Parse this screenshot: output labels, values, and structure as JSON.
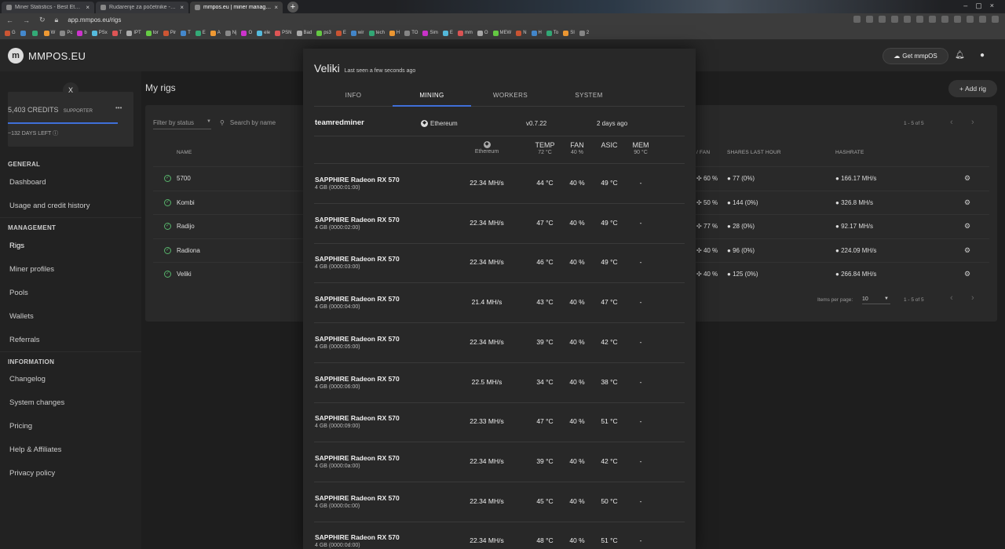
{
  "browser": {
    "tabs": [
      {
        "label": "Miner Statistics - Best Ethereum",
        "active": false
      },
      {
        "label": "Rudarenje za početnike - ČITAJ",
        "active": false
      },
      {
        "label": "mmpos.eu | miner management",
        "active": true
      }
    ],
    "url": "app.mmpos.eu/rigs",
    "bookmarks": [
      "G",
      "",
      "",
      "W",
      "Pc",
      "b",
      "PSx",
      "T",
      "IPT",
      "tor",
      "Pir",
      "T",
      "E",
      "A",
      "Nj",
      "O",
      "ele",
      "PSN",
      "Bad",
      "ps3",
      "E",
      "wir",
      "tech",
      "H",
      "TO",
      "Sim",
      "E",
      "mm",
      "O",
      "MEW",
      "N",
      "H",
      "To",
      "SI",
      "2"
    ]
  },
  "app": {
    "logo": "MMPOS.EU",
    "get_label": "Get mmpOS"
  },
  "sidebar": {
    "close": "X",
    "credits": "5,403 CREDITS",
    "badge": "SUPPORTER",
    "more": "•••",
    "credits_fill": 1.0,
    "days_left": "~132 DAYS LEFT",
    "sections": {
      "general": "GENERAL",
      "management": "MANAGEMENT",
      "information": "INFORMATION"
    },
    "items": {
      "dashboard": "Dashboard",
      "usage": "Usage and credit history",
      "rigs": "Rigs",
      "profiles": "Miner profiles",
      "pools": "Pools",
      "wallets": "Wallets",
      "referrals": "Referrals",
      "changelog": "Changelog",
      "system_changes": "System changes",
      "pricing": "Pricing",
      "help": "Help & Affiliates",
      "privacy": "Privacy policy"
    }
  },
  "main": {
    "title": "My rigs",
    "add_rig": "Add rig",
    "filter": "Filter by status",
    "search": "Search by name",
    "pager_top": "1 - 5 of 5",
    "pager_bottom": "1 - 5 of 5",
    "items_per_page_label": "Items per page:",
    "items_per_page": "10",
    "columns": {
      "name": "NAME",
      "fan": "/ FAN",
      "shares": "SHARES LAST HOUR",
      "hashrate": "HASHRATE"
    },
    "rigs": [
      {
        "name": "5700",
        "fan": "60 %",
        "shares": "77 (0%)",
        "hashrate": "166.17 MH/s"
      },
      {
        "name": "Kombi",
        "fan": "50 %",
        "shares": "144 (0%)",
        "hashrate": "326.8 MH/s"
      },
      {
        "name": "Radijo",
        "fan": "77 %",
        "shares": "28 (0%)",
        "hashrate": "92.17 MH/s"
      },
      {
        "name": "Radiona",
        "fan": "40 %",
        "shares": "96 (0%)",
        "hashrate": "224.09 MH/s"
      },
      {
        "name": "Veliki",
        "fan": "40 %",
        "shares": "125 (0%)",
        "hashrate": "266.84 MH/s"
      }
    ]
  },
  "modal": {
    "title": "Veliki",
    "subtitle": "Last seen a few seconds ago",
    "tabs": [
      "INFO",
      "MINING",
      "WORKERS",
      "SYSTEM"
    ],
    "active_tab": 1,
    "miner": {
      "name": "teamredminer",
      "coin": "Ethereum",
      "version": "v0.7.22",
      "ago": "2 days ago"
    },
    "headers": {
      "coin": "Ethereum",
      "temp": "TEMP",
      "temp_sub": "72 °C",
      "fan": "FAN",
      "fan_sub": "40 %",
      "asic": "ASIC",
      "mem": "MEM",
      "mem_sub": "90 °C"
    },
    "gpus": [
      {
        "name": "SAPPHIRE Radeon RX 570",
        "bus": "4 GB (0000:01:00)",
        "hash": "22.34 MH/s",
        "temp": "44 °C",
        "fan": "40 %",
        "asic": "49 °C",
        "mem": "-"
      },
      {
        "name": "SAPPHIRE Radeon RX 570",
        "bus": "4 GB (0000:02:00)",
        "hash": "22.34 MH/s",
        "temp": "47 °C",
        "fan": "40 %",
        "asic": "49 °C",
        "mem": "-"
      },
      {
        "name": "SAPPHIRE Radeon RX 570",
        "bus": "4 GB (0000:03:00)",
        "hash": "22.34 MH/s",
        "temp": "46 °C",
        "fan": "40 %",
        "asic": "49 °C",
        "mem": "-"
      },
      {
        "name": "SAPPHIRE Radeon RX 570",
        "bus": "4 GB (0000:04:00)",
        "hash": "21.4 MH/s",
        "temp": "43 °C",
        "fan": "40 %",
        "asic": "47 °C",
        "mem": "-"
      },
      {
        "name": "SAPPHIRE Radeon RX 570",
        "bus": "4 GB (0000:05:00)",
        "hash": "22.34 MH/s",
        "temp": "39 °C",
        "fan": "40 %",
        "asic": "42 °C",
        "mem": "-"
      },
      {
        "name": "SAPPHIRE Radeon RX 570",
        "bus": "4 GB (0000:06:00)",
        "hash": "22.5 MH/s",
        "temp": "34 °C",
        "fan": "40 %",
        "asic": "38 °C",
        "mem": "-"
      },
      {
        "name": "SAPPHIRE Radeon RX 570",
        "bus": "4 GB (0000:09:00)",
        "hash": "22.33 MH/s",
        "temp": "47 °C",
        "fan": "40 %",
        "asic": "51 °C",
        "mem": "-"
      },
      {
        "name": "SAPPHIRE Radeon RX 570",
        "bus": "4 GB (0000:0a:00)",
        "hash": "22.34 MH/s",
        "temp": "39 °C",
        "fan": "40 %",
        "asic": "42 °C",
        "mem": "-"
      },
      {
        "name": "SAPPHIRE Radeon RX 570",
        "bus": "4 GB (0000:0c:00)",
        "hash": "22.34 MH/s",
        "temp": "45 °C",
        "fan": "40 %",
        "asic": "50 °C",
        "mem": "-"
      },
      {
        "name": "SAPPHIRE Radeon RX 570",
        "bus": "4 GB (0000:0d:00)",
        "hash": "22.34 MH/s",
        "temp": "48 °C",
        "fan": "40 %",
        "asic": "51 °C",
        "mem": "-"
      }
    ]
  },
  "colors": {
    "accent": "#3f6fd8",
    "status_ok": "#57b36b"
  },
  "icons": [
    "back-icon",
    "forward-icon",
    "reload-icon",
    "cloud-download-icon",
    "bell-icon",
    "user-icon",
    "plus-icon",
    "search-icon",
    "check-circle-icon",
    "fan-icon",
    "share-icon",
    "speed-icon",
    "gear-icon",
    "ethereum-icon"
  ]
}
